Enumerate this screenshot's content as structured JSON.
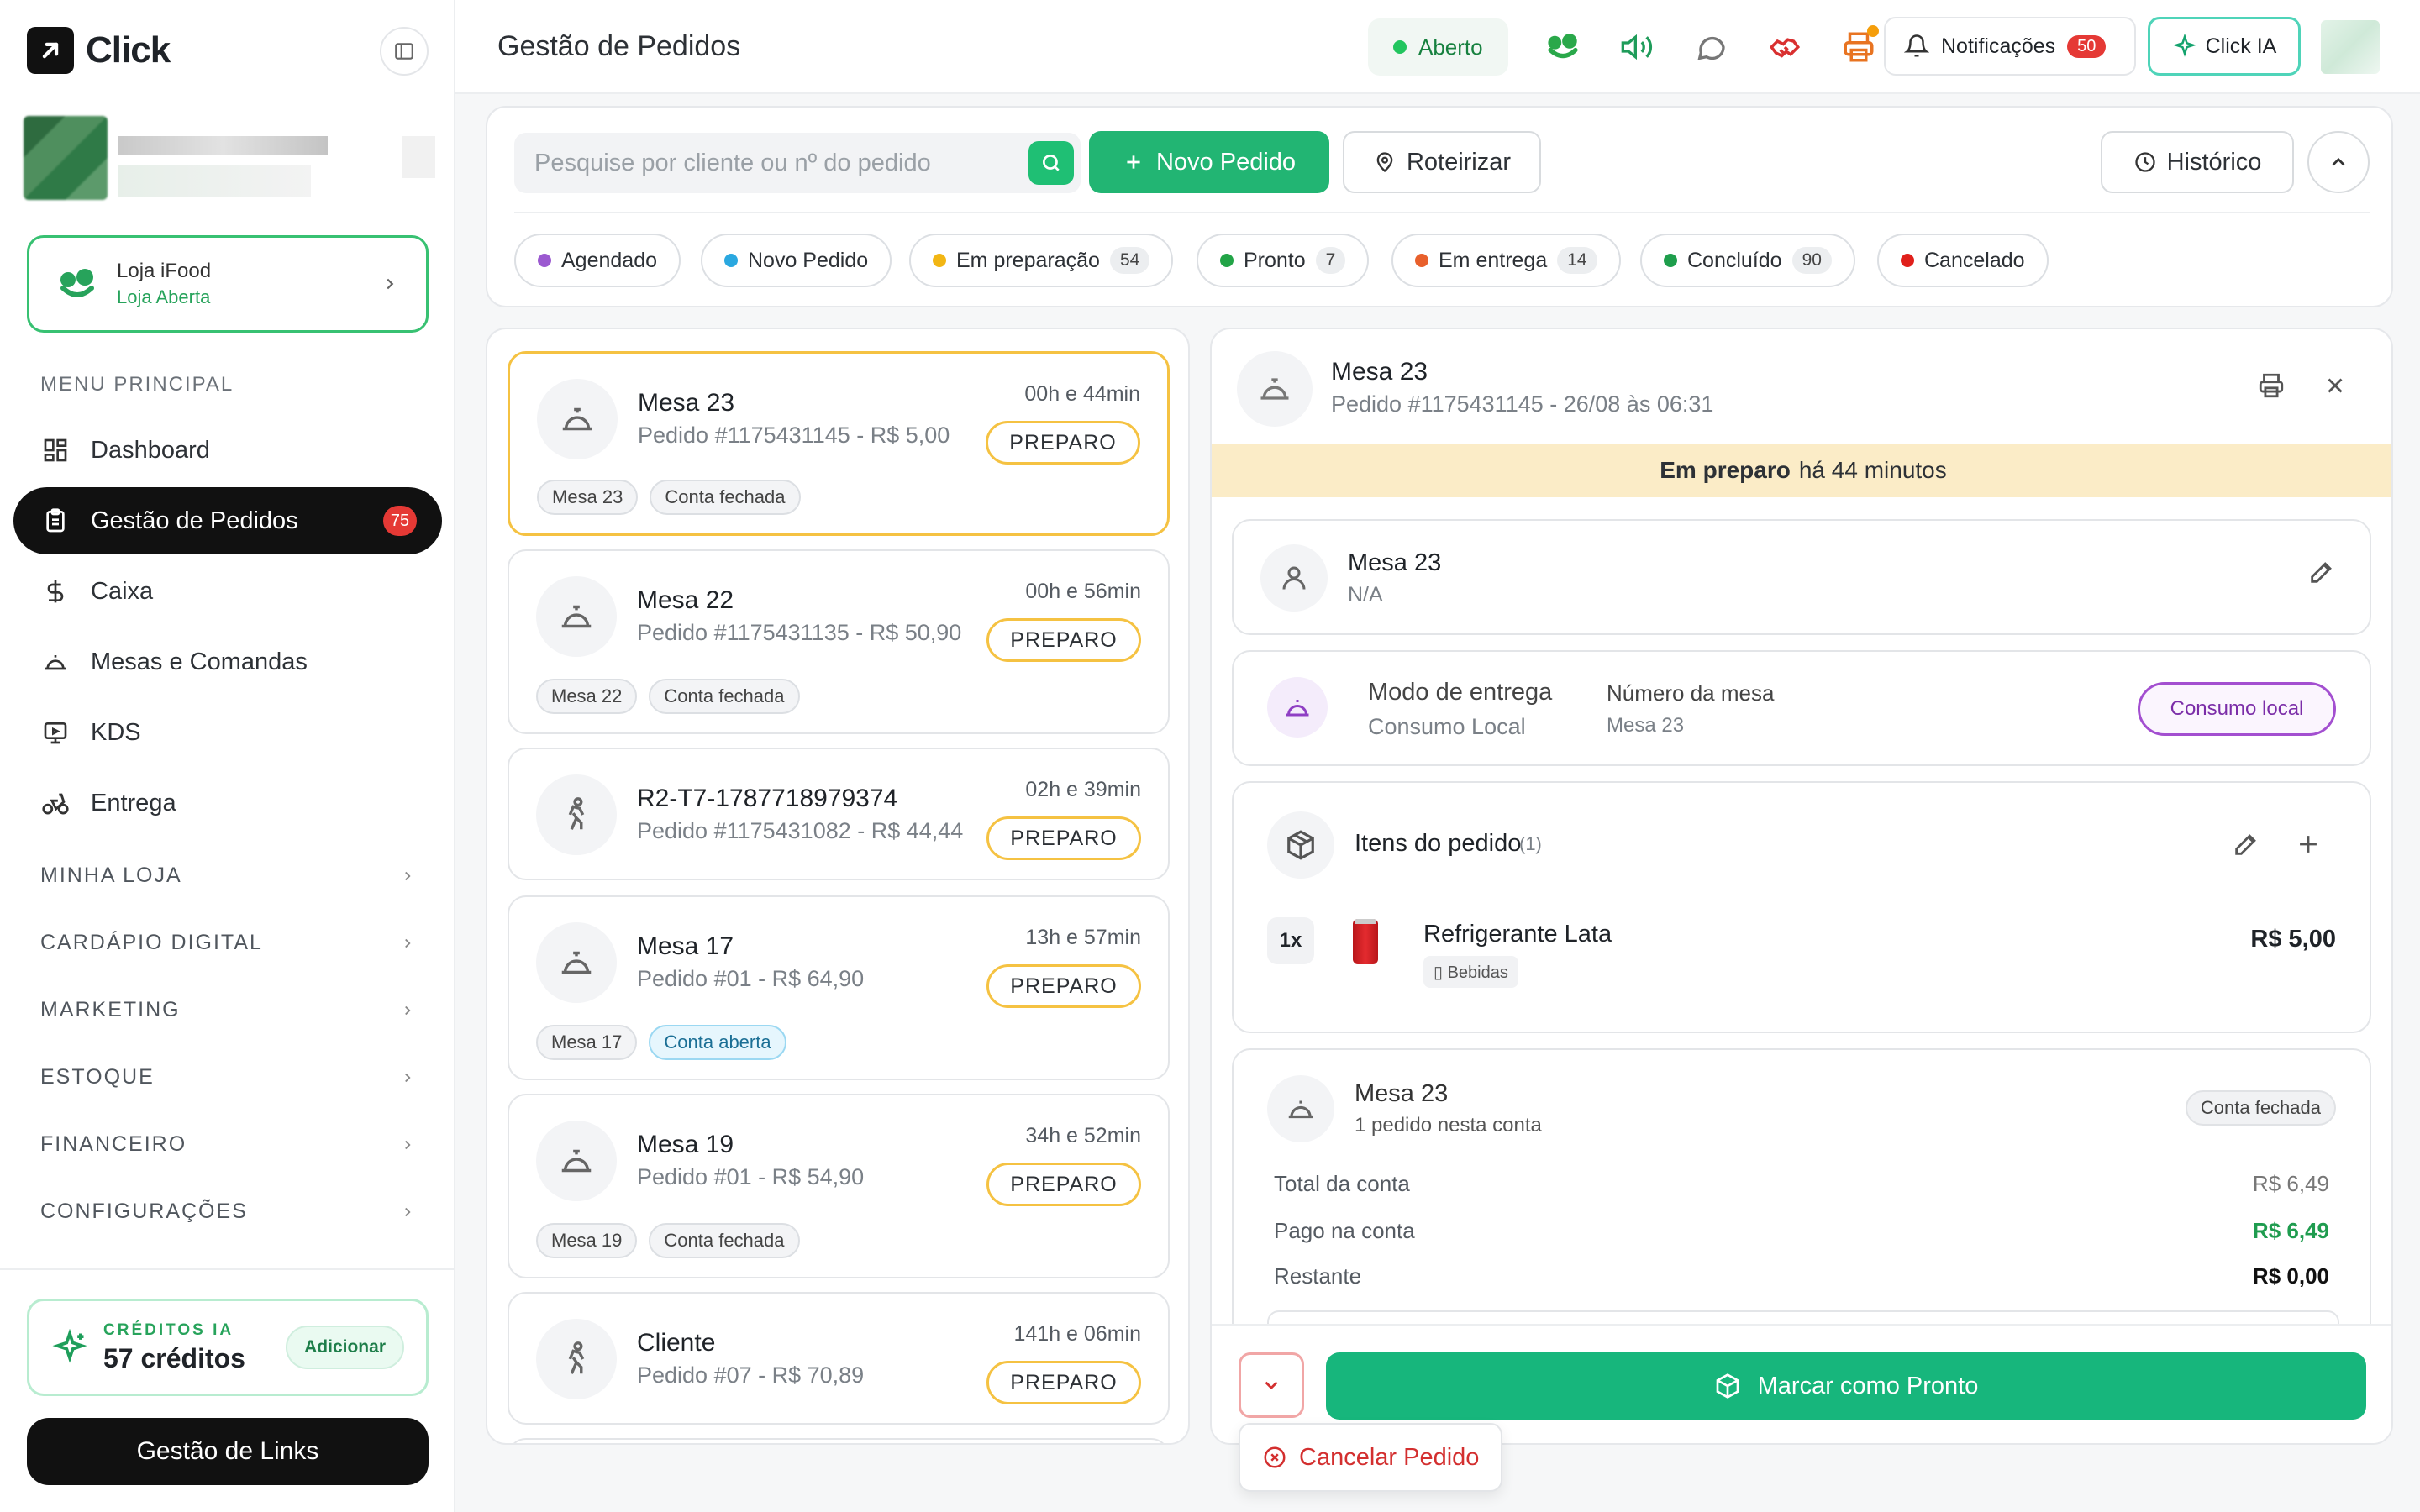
{
  "brand": {
    "name": "Click"
  },
  "store": {
    "title": "Loja iFood",
    "status": "Loja Aberta"
  },
  "sidebar": {
    "menu_label": "MENU PRINCIPAL",
    "items": [
      {
        "label": "Dashboard"
      },
      {
        "label": "Gestão de Pedidos",
        "badge": "75"
      },
      {
        "label": "Caixa"
      },
      {
        "label": "Mesas e Comandas"
      },
      {
        "label": "KDS"
      },
      {
        "label": "Entrega"
      }
    ],
    "groups": [
      {
        "label": "MINHA LOJA"
      },
      {
        "label": "CARDÁPIO DIGITAL"
      },
      {
        "label": "MARKETING"
      },
      {
        "label": "ESTOQUE"
      },
      {
        "label": "FINANCEIRO"
      },
      {
        "label": "CONFIGURAÇÕES"
      }
    ],
    "credits": {
      "label": "CRÉDITOS IA",
      "value": "57 créditos",
      "add": "Adicionar"
    },
    "links_button": "Gestão de Links"
  },
  "topbar": {
    "title": "Gestão de Pedidos",
    "status": "Aberto",
    "notifications_label": "Notificações",
    "notifications_count": "50",
    "ia_label": "Click IA"
  },
  "filters": {
    "search_placeholder": "Pesquise por cliente ou nº do pedido",
    "new_order": "Novo Pedido",
    "route": "Roteirizar",
    "history": "Histórico",
    "chips": [
      {
        "label": "Agendado",
        "count": "",
        "color": "#9b59d0"
      },
      {
        "label": "Novo Pedido",
        "count": "",
        "color": "#2aa8e0"
      },
      {
        "label": "Em preparação",
        "count": "54",
        "color": "#f2b614"
      },
      {
        "label": "Pronto",
        "count": "7",
        "color": "#22a447"
      },
      {
        "label": "Em entrega",
        "count": "14",
        "color": "#e8602c"
      },
      {
        "label": "Concluído",
        "count": "90",
        "color": "#1e9e4c"
      },
      {
        "label": "Cancelado",
        "count": "",
        "color": "#e0201b"
      }
    ]
  },
  "orders": [
    {
      "title": "Mesa 23",
      "subtitle": "Pedido #1175431145 - R$ 5,00",
      "time": "00h e 44min",
      "status": "PREPARO",
      "tags": [
        "Mesa 23",
        "Conta fechada"
      ],
      "icon": "bell-icon"
    },
    {
      "title": "Mesa 22",
      "subtitle": "Pedido #1175431135 - R$ 50,90",
      "time": "00h e 56min",
      "status": "PREPARO",
      "tags": [
        "Mesa 22",
        "Conta fechada"
      ],
      "icon": "bell-icon"
    },
    {
      "title": "R2-T7-1787718979374",
      "subtitle": "Pedido #1175431082 - R$ 44,44",
      "time": "02h e 39min",
      "status": "PREPARO",
      "tags": [],
      "icon": "walk-icon"
    },
    {
      "title": "Mesa 17",
      "subtitle": "Pedido #01 - R$ 64,90",
      "time": "13h e 57min",
      "status": "PREPARO",
      "tags": [
        "Mesa 17",
        "Conta aberta"
      ],
      "icon": "bell-icon"
    },
    {
      "title": "Mesa 19",
      "subtitle": "Pedido #01 - R$ 54,90",
      "time": "34h e 52min",
      "status": "PREPARO",
      "tags": [
        "Mesa 19",
        "Conta fechada"
      ],
      "icon": "bell-icon"
    },
    {
      "title": "Cliente",
      "subtitle": "Pedido #07 - R$ 70,89",
      "time": "141h e 06min",
      "status": "PREPARO",
      "tags": [],
      "icon": "walk-icon"
    }
  ],
  "detail": {
    "title": "Mesa 23",
    "subtitle": "Pedido #1175431145 - 26/08 às 06:31",
    "banner_strong": "Em preparo",
    "banner_rest": "há 44 minutos",
    "customer_name": "Mesa 23",
    "customer_sub": "N/A",
    "delivery_mode_label": "Modo de entrega",
    "delivery_mode_value": "Consumo Local",
    "table_label": "Número da mesa",
    "table_value": "Mesa 23",
    "consumo_pill": "Consumo local",
    "items_label": "Itens do pedido",
    "items_count": "(1)",
    "item": {
      "qty": "1x",
      "name": "Refrigerante Lata",
      "category": "▯ Bebidas",
      "price": "R$ 5,00"
    },
    "account": {
      "title": "Mesa 23",
      "subtitle": "1 pedido nesta conta",
      "tag": "Conta fechada",
      "total_label": "Total da conta",
      "total": "R$ 6,49",
      "paid_label": "Pago na conta",
      "paid": "R$ 6,49",
      "rest_label": "Restante",
      "rest": "R$ 0,00"
    },
    "ready_button": "Marcar como Pronto",
    "cancel_button": "Cancelar Pedido"
  }
}
